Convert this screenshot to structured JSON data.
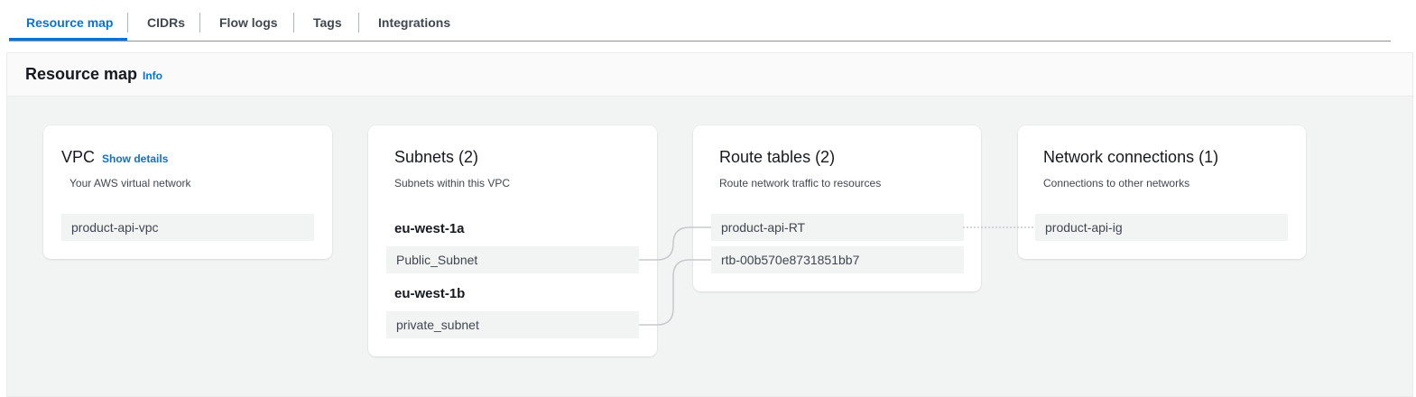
{
  "tabs": [
    {
      "label": "Resource map",
      "active": true
    },
    {
      "label": "CIDRs",
      "active": false
    },
    {
      "label": "Flow logs",
      "active": false
    },
    {
      "label": "Tags",
      "active": false
    },
    {
      "label": "Integrations",
      "active": false
    }
  ],
  "panel": {
    "title": "Resource map",
    "info_label": "Info"
  },
  "vpc": {
    "title": "VPC",
    "details_label": "Show details",
    "description": "Your AWS virtual network",
    "item": "product-api-vpc"
  },
  "subnets": {
    "title": "Subnets (2)",
    "description": "Subnets within this VPC",
    "zones": [
      {
        "name": "eu-west-1a",
        "subnet": "Public_Subnet"
      },
      {
        "name": "eu-west-1b",
        "subnet": "private_subnet"
      }
    ]
  },
  "route_tables": {
    "title": "Route tables (2)",
    "description": "Route network traffic to resources",
    "items": [
      "product-api-RT",
      "rtb-00b570e8731851bb7"
    ]
  },
  "network_connections": {
    "title": "Network connections (1)",
    "description": "Connections to other networks",
    "items": [
      "product-api-ig"
    ]
  },
  "colors": {
    "accent": "#0972d3",
    "connector": "#c6c9cc"
  }
}
